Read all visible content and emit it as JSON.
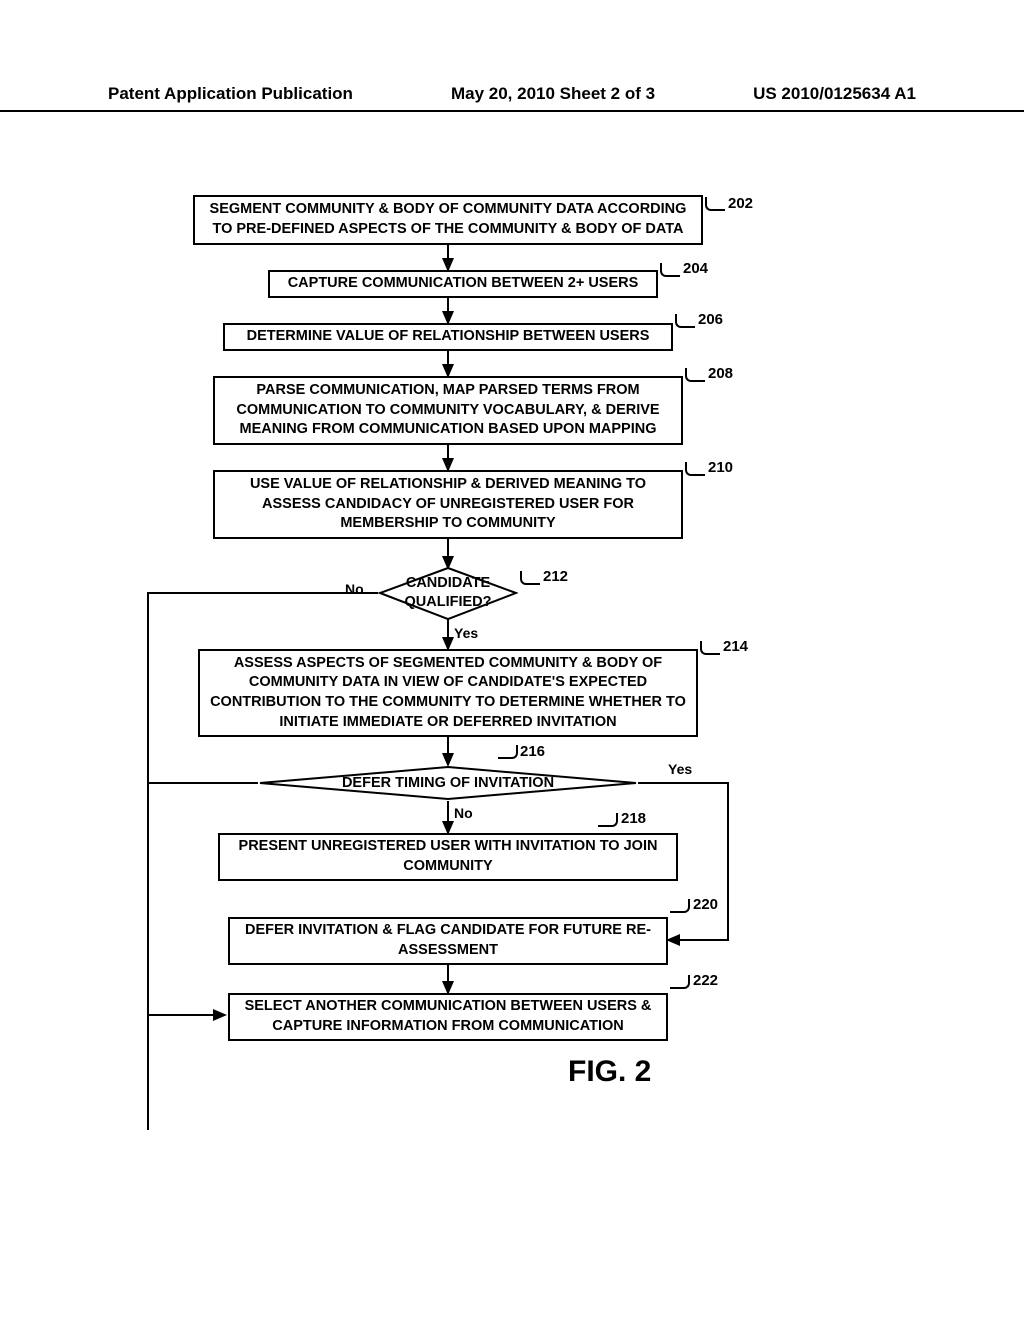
{
  "header": {
    "left": "Patent Application Publication",
    "center": "May 20, 2010  Sheet 2 of 3",
    "right": "US 2010/0125634 A1"
  },
  "boxes": {
    "b202": "SEGMENT COMMUNITY & BODY OF COMMUNITY DATA ACCORDING TO PRE-DEFINED ASPECTS OF THE COMMUNITY & BODY OF DATA",
    "b204": "CAPTURE COMMUNICATION BETWEEN 2+ USERS",
    "b206": "DETERMINE VALUE OF RELATIONSHIP BETWEEN USERS",
    "b208": "PARSE COMMUNICATION, MAP PARSED TERMS FROM COMMUNICATION TO COMMUNITY VOCABULARY, & DERIVE MEANING FROM COMMUNICATION BASED UPON MAPPING",
    "b210": "USE VALUE OF RELATIONSHIP & DERIVED MEANING TO ASSESS CANDIDACY OF UNREGISTERED USER FOR MEMBERSHIP TO COMMUNITY",
    "b212": "CANDIDATE QUALIFIED?",
    "b214": "ASSESS ASPECTS OF SEGMENTED COMMUNITY & BODY OF COMMUNITY DATA IN VIEW OF CANDIDATE'S EXPECTED CONTRIBUTION TO THE COMMUNITY TO DETERMINE  WHETHER TO INITIATE IMMEDIATE  OR DEFERRED  INVITATION",
    "b216": "DEFER TIMING OF INVITATION",
    "b218": "PRESENT UNREGISTERED USER WITH INVITATION TO JOIN COMMUNITY",
    "b220": "DEFER INVITATION & FLAG CANDIDATE FOR FUTURE RE-ASSESSMENT",
    "b222": "SELECT ANOTHER COMMUNICATION BETWEEN USERS & CAPTURE INFORMATION FROM COMMUNICATION"
  },
  "refs": {
    "r202": "202",
    "r204": "204",
    "r206": "206",
    "r208": "208",
    "r210": "210",
    "r212": "212",
    "r214": "214",
    "r216": "216",
    "r218": "218",
    "r220": "220",
    "r222": "222"
  },
  "labels": {
    "no": "No",
    "yes": "Yes"
  },
  "figure": "FIG. 2"
}
